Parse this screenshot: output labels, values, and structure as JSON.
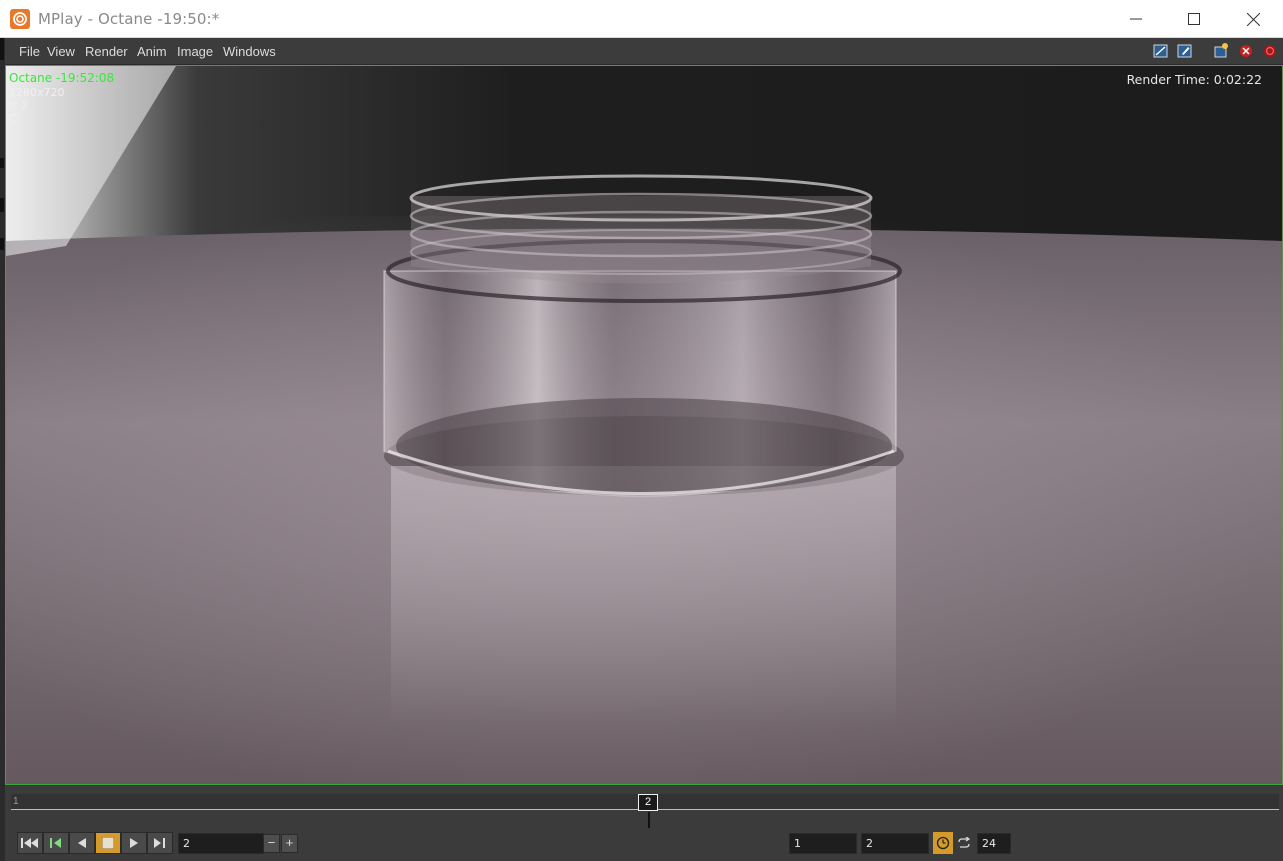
{
  "window": {
    "title": "MPlay - Octane -19:50:*",
    "app_icon": "houdini-logo-icon",
    "controls": [
      "minimize-icon",
      "maximize-icon",
      "close-icon"
    ]
  },
  "menubar": {
    "items": [
      "File",
      "View",
      "Render",
      "Anim",
      "Image",
      "Windows"
    ],
    "toolbar_icons": [
      "fit-window-icon",
      "edit-settings-icon",
      "snapshot-icon",
      "stop-render-icon",
      "close-render-icon"
    ]
  },
  "viewport": {
    "image_name": "Octane -19:52:08",
    "resolution": "1280x720",
    "frame": "fr 2",
    "channel": "C",
    "render_time": "Render Time: 0:02:22"
  },
  "timeline": {
    "start_label": "1",
    "current_frame_marker": "2"
  },
  "playback": {
    "buttons": [
      "first-frame-icon",
      "step-back-icon",
      "play-reverse-icon",
      "stop-icon",
      "play-icon",
      "last-frame-icon"
    ],
    "current_frame": "2",
    "minus_label": "−",
    "plus_label": "+",
    "range_start": "1",
    "range_end": "2",
    "fps": "24"
  },
  "colors": {
    "accent": "#d49a2a",
    "viewport_border": "#39a839",
    "overlay_green": "#3be63b"
  }
}
